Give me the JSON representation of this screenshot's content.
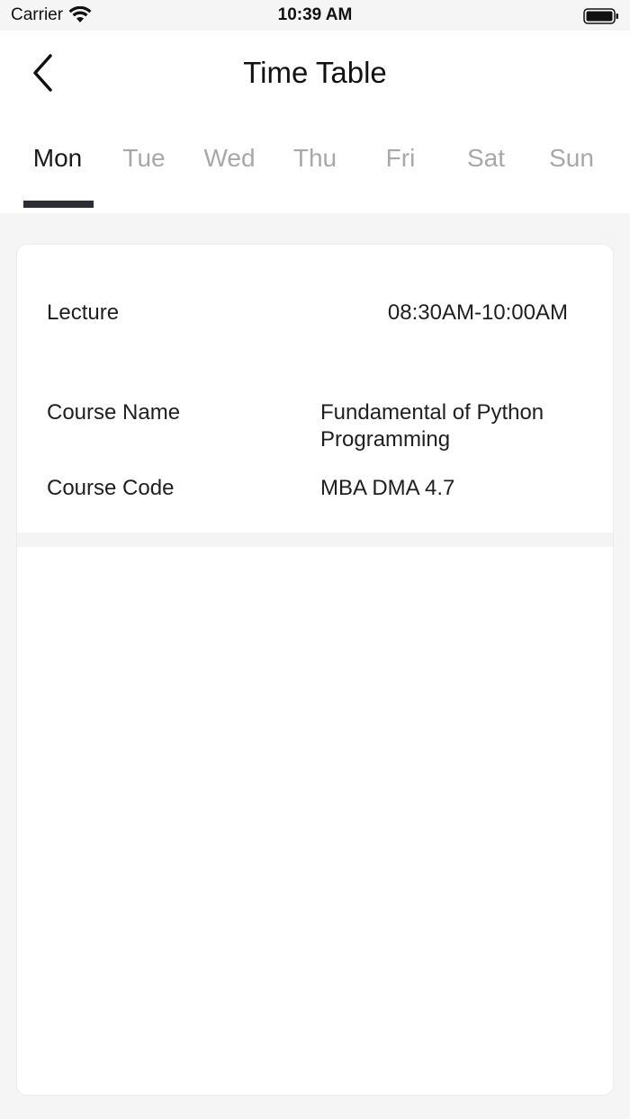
{
  "status_bar": {
    "carrier": "Carrier",
    "time": "10:39 AM"
  },
  "header": {
    "title": "Time Table"
  },
  "tabs": [
    {
      "label": "Mon",
      "active": true
    },
    {
      "label": "Tue",
      "active": false
    },
    {
      "label": "Wed",
      "active": false
    },
    {
      "label": "Thu",
      "active": false
    },
    {
      "label": "Fri",
      "active": false
    },
    {
      "label": "Sat",
      "active": false
    },
    {
      "label": "Sun",
      "active": false
    }
  ],
  "lecture": {
    "label": "Lecture",
    "time": "08:30AM-10:00AM",
    "course_name_label": "Course Name",
    "course_name_line1": "Fundamental of Python",
    "course_name_line2": "Programming",
    "course_code_label": "Course Code",
    "course_code": "MBA DMA 4.7"
  },
  "colors": {
    "active_tab": "#1a1a1a",
    "inactive_tab": "#a8a8a8",
    "indicator": "#2b2f33",
    "background": "#f5f5f5"
  }
}
